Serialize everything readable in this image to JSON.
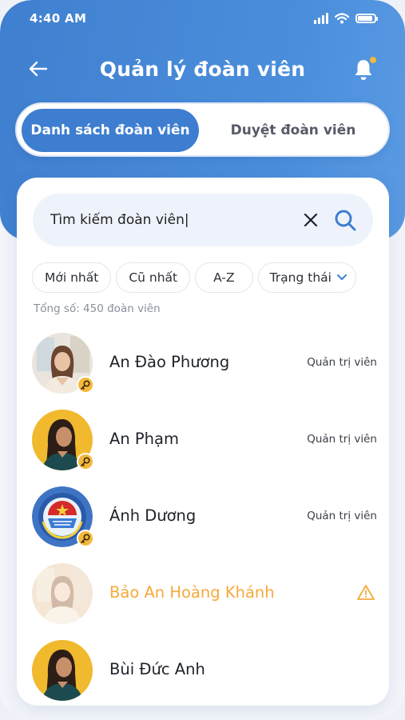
{
  "status_bar": {
    "time": "4:40 AM"
  },
  "header": {
    "title": "Quản lý đoàn viên"
  },
  "tabs": [
    {
      "label": "Danh sách đoàn viên",
      "active": true
    },
    {
      "label": "Duyệt đoàn viên",
      "active": false
    }
  ],
  "search": {
    "value": "Tìm kiếm đoàn viên|",
    "placeholder": "Tìm kiếm đoàn viên"
  },
  "filters": [
    "Mới nhất",
    "Cũ nhất",
    "A-Z",
    "Trạng thái"
  ],
  "total_label": "Tổng số: 450 đoàn viên",
  "members": [
    {
      "name": "An Đào Phương",
      "role": "Quản trị viên",
      "avatar": "photo-woman-window",
      "admin": true
    },
    {
      "name": "An Phạm",
      "role": "Quản trị viên",
      "avatar": "photo-woman-yellow",
      "admin": true
    },
    {
      "name": "Ánh Dương",
      "role": "Quản trị viên",
      "avatar": "union-emblem",
      "admin": true
    },
    {
      "name": "Bảo An Hoàng Khánh",
      "role": "",
      "avatar": "photo-woman-window",
      "admin": false,
      "warning": true
    },
    {
      "name": "Bùi Đức Anh",
      "role": "",
      "avatar": "photo-woman-yellow",
      "admin": false
    }
  ],
  "colors": {
    "primary": "#3e7ed0",
    "accent": "#f5b83c",
    "warning": "#f5a93b"
  }
}
